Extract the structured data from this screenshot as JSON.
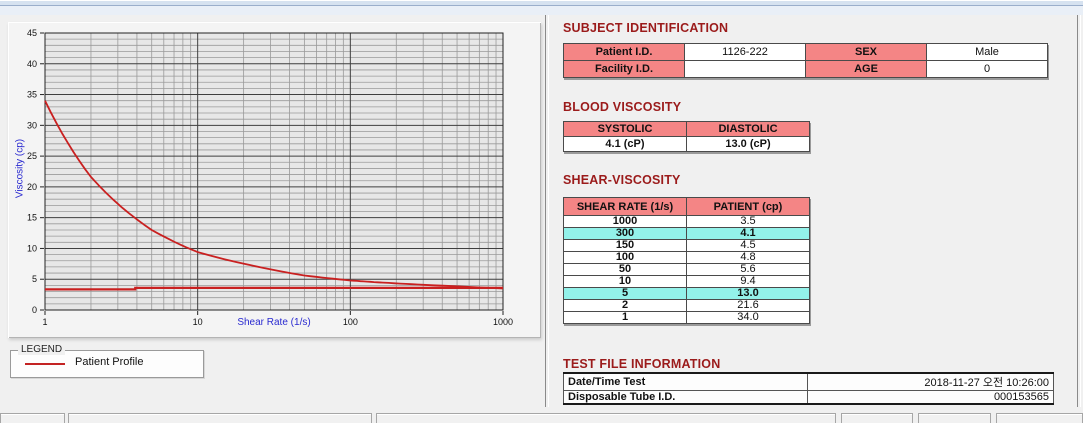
{
  "titles": {
    "subject": "SUBJECT IDENTIFICATION",
    "blood": "BLOOD VISCOSITY",
    "shear": "SHEAR-VISCOSITY",
    "test_file": "TEST FILE INFORMATION"
  },
  "subject_table": {
    "rows": [
      {
        "label1": "Patient I.D.",
        "value1": "1126-222",
        "label2": "SEX",
        "value2": "Male"
      },
      {
        "label1": "Facility I.D.",
        "value1": "",
        "label2": "AGE",
        "value2": "0"
      }
    ]
  },
  "blood_table": {
    "headers": [
      "SYSTOLIC",
      "DIASTOLIC"
    ],
    "values": [
      "4.1 (cP)",
      "13.0 (cP)"
    ]
  },
  "shear_table": {
    "headers": [
      "SHEAR RATE (1/s)",
      "PATIENT (cp)"
    ],
    "rows": [
      {
        "rate": "1000",
        "value": "3.5",
        "highlight": false
      },
      {
        "rate": "300",
        "value": "4.1",
        "highlight": true
      },
      {
        "rate": "150",
        "value": "4.5",
        "highlight": false
      },
      {
        "rate": "100",
        "value": "4.8",
        "highlight": false
      },
      {
        "rate": "50",
        "value": "5.6",
        "highlight": false
      },
      {
        "rate": "10",
        "value": "9.4",
        "highlight": false
      },
      {
        "rate": "5",
        "value": "13.0",
        "highlight": true
      },
      {
        "rate": "2",
        "value": "21.6",
        "highlight": false
      },
      {
        "rate": "1",
        "value": "34.0",
        "highlight": false
      }
    ]
  },
  "test_file_table": {
    "rows": [
      {
        "label": "Date/Time Test",
        "value": "2018-11-27  오전 10:26:00"
      },
      {
        "label": "Disposable Tube I.D.",
        "value": "000153565"
      }
    ]
  },
  "chart": {
    "y_label": "Viscosity (cp)",
    "x_label": "Shear Rate (1/s)",
    "legend": {
      "box_label": "LEGEND",
      "series_label": "Patient Profile"
    },
    "colors": {
      "series_red": "#c92020",
      "axis_label_blue": "#2a2ad0",
      "section_title_maroon": "#9b1b1b",
      "table_header_pink": "#f48585",
      "highlight_cyan": "#93f2ea"
    },
    "chart_data": {
      "type": "line",
      "title": "",
      "xlabel": "Shear Rate (1/s)",
      "ylabel": "Viscosity (cp)",
      "x_scale": "log",
      "xlim": [
        1,
        1000
      ],
      "ylim": [
        0,
        45
      ],
      "y_ticks": [
        45,
        40,
        35,
        30,
        25,
        20,
        15,
        10,
        5,
        0
      ],
      "x_ticks": [
        1,
        10,
        100,
        1000
      ],
      "grid": true,
      "legend_position": "below-left",
      "series": [
        {
          "name": "Patient Profile",
          "color": "#c92020",
          "points": [
            [
              1,
              34.0
            ],
            [
              2,
              21.6
            ],
            [
              5,
              13.0
            ],
            [
              10,
              9.4
            ],
            [
              50,
              5.6
            ],
            [
              100,
              4.8
            ],
            [
              150,
              4.5
            ],
            [
              300,
              4.1
            ],
            [
              1000,
              3.5
            ]
          ]
        }
      ],
      "baseline_segments": [
        {
          "x1": 1,
          "x2": 3.9,
          "y": 3.35
        },
        {
          "x1": 3.9,
          "x2": 1000,
          "y": 3.6
        }
      ]
    }
  }
}
